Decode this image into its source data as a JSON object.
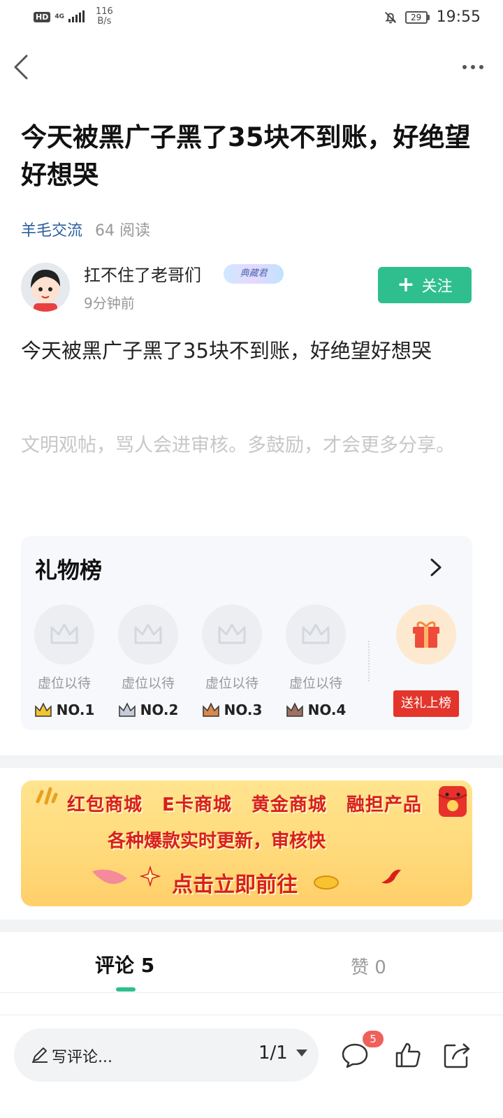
{
  "status_bar": {
    "hd": "HD",
    "network": "4G",
    "speed_value": "116",
    "speed_unit": "B/s",
    "battery": "29",
    "time": "19:55"
  },
  "icons": {
    "back": "chevron-left-icon",
    "more": "more-dots-icon",
    "mute": "bell-off-icon",
    "gift_arrow": "chevron-right-icon",
    "crown": "crown-icon",
    "gift": "gift-box-icon",
    "pencil": "pencil-icon",
    "comment": "comment-bubble-icon",
    "like": "thumbs-up-icon",
    "share": "share-icon"
  },
  "post": {
    "title": "今天被黑广子黑了35块不到账，好绝望好想哭",
    "category": "羊毛交流",
    "reads": "64 阅读",
    "body": "今天被黑广子黑了35块不到账，好绝望好想哭",
    "civil_note": "文明观帖，骂人会进审核。多鼓励，才会更多分享。"
  },
  "author": {
    "name": "扛不住了老哥们",
    "badge_text": "典藏君",
    "time": "9分钟前",
    "follow_label": "关注"
  },
  "gift_board": {
    "title": "礼物榜",
    "slots": [
      {
        "text": "虚位以待",
        "rank": "NO.1",
        "crown_color": "#f4c430"
      },
      {
        "text": "虚位以待",
        "rank": "NO.2",
        "crown_color": "#c7cdd6"
      },
      {
        "text": "虚位以待",
        "rank": "NO.3",
        "crown_color": "#d9894a"
      },
      {
        "text": "虚位以待",
        "rank": "NO.4",
        "crown_color": "#a07060"
      }
    ],
    "send_label": "送礼上榜"
  },
  "banner": {
    "line1": "红包商城 E卡商城 黄金商城 融担产品",
    "line2": "各种爆款实时更新，审核快",
    "cta": "点击立即前往"
  },
  "tabs": {
    "comments": "评论 5",
    "likes": "赞 0"
  },
  "bottom_bar": {
    "placeholder": "写评论...",
    "page": "1/1",
    "comment_count": "5"
  },
  "colors": {
    "accent": "#2fbf8f",
    "category": "#2b5f9e",
    "danger": "#e3352b"
  }
}
